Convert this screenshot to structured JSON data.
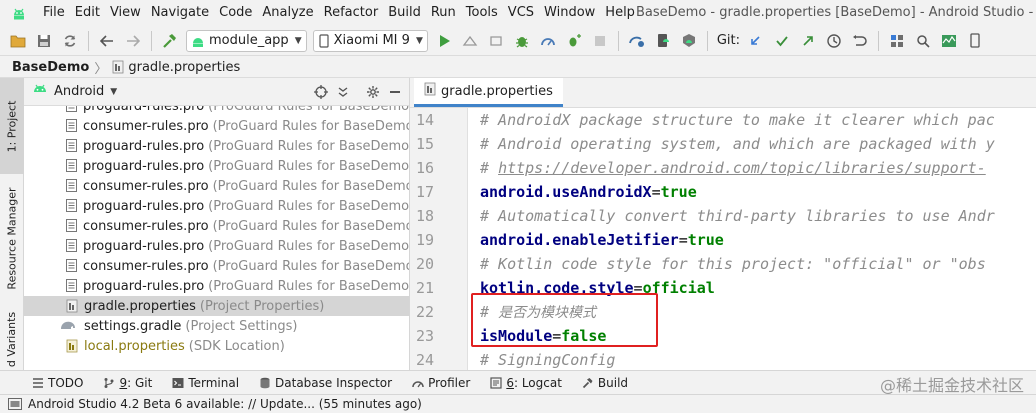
{
  "menu": {
    "items": [
      "File",
      "Edit",
      "View",
      "Navigate",
      "Code",
      "Analyze",
      "Refactor",
      "Build",
      "Run",
      "Tools",
      "VCS",
      "Window",
      "Help"
    ],
    "window_title": "BaseDemo - gradle.properties [BaseDemo] - Android Studio - Admi"
  },
  "toolbar": {
    "config_combo": "module_app",
    "device_combo": "Xiaomi MI 9",
    "git_label": "Git:"
  },
  "breadcrumb": {
    "root": "BaseDemo",
    "file": "gradle.properties"
  },
  "left_strip": {
    "project_tab": "1: Project",
    "resource_manager_tab": "Resource Manager",
    "build_variants_tab": "d Variants"
  },
  "project_panel": {
    "view_label": "Android",
    "rows": [
      {
        "name": "proguard-rules.pro",
        "desc": "(ProGuard Rules for BaseDemo.lib_r"
      },
      {
        "name": "consumer-rules.pro",
        "desc": "(ProGuard Rules for BaseDemo.lib_r"
      },
      {
        "name": "proguard-rules.pro",
        "desc": "(ProGuard Rules for BaseDemo.lib_r"
      },
      {
        "name": "proguard-rules.pro",
        "desc": "(ProGuard Rules for BaseDemo.moc"
      },
      {
        "name": "consumer-rules.pro",
        "desc": "(ProGuard Rules for BaseDemo.moc"
      },
      {
        "name": "proguard-rules.pro",
        "desc": "(ProGuard Rules for BaseDemo.moc"
      },
      {
        "name": "consumer-rules.pro",
        "desc": "(ProGuard Rules for BaseDemo.mou"
      },
      {
        "name": "proguard-rules.pro",
        "desc": "(ProGuard Rules for BaseDemo.mou"
      },
      {
        "name": "consumer-rules.pro",
        "desc": "(ProGuard Rules for BaseDemo.mou"
      },
      {
        "name": "proguard-rules.pro",
        "desc": "(ProGuard Rules for BaseDemo.mou"
      },
      {
        "name": "gradle.properties",
        "desc": "(Project Properties)"
      },
      {
        "name": "settings.gradle",
        "desc": "(Project Settings)"
      },
      {
        "name": "local.properties",
        "desc": "(SDK Location)"
      }
    ]
  },
  "editor": {
    "tab_label": "gradle.properties",
    "lines": [
      {
        "num": "14",
        "comment": "# AndroidX package structure to make it clearer which pac"
      },
      {
        "num": "15",
        "comment": "# Android operating system, and which are packaged with y"
      },
      {
        "num": "16",
        "comment_prefix": "# ",
        "link": "https://developer.android.com/topic/libraries/support-"
      },
      {
        "num": "17",
        "key": "android.useAndroidX",
        "eq": "=",
        "val": "true"
      },
      {
        "num": "18",
        "comment": "# Automatically convert third-party libraries to use Andr"
      },
      {
        "num": "19",
        "key": "android.enableJetifier",
        "eq": "=",
        "val": "true"
      },
      {
        "num": "20",
        "comment": "# Kotlin code style for this project: \"official\" or \"obs"
      },
      {
        "num": "21",
        "key": "kotlin.code.style",
        "eq": "=",
        "val": "official"
      },
      {
        "num": "22",
        "comment_prefix": "# ",
        "cn": "是否为模块模式"
      },
      {
        "num": "23",
        "key": "isModule",
        "eq": "=",
        "val": "false"
      },
      {
        "num": "24",
        "comment": "# SigningConfig"
      }
    ]
  },
  "bottom_tools": {
    "todo": "TODO",
    "git_num": "9",
    "git_rest": ": Git",
    "terminal": "Terminal",
    "db_inspector": "Database Inspector",
    "profiler": "Profiler",
    "logcat_num": "6",
    "logcat_rest": ": Logcat",
    "build": "Build"
  },
  "watermark": "@稀土掘金技术社区",
  "status": {
    "message": "Android Studio 4.2 Beta 6 available: // Update... (55 minutes ago)"
  },
  "colors": {
    "accent": "#4083c9",
    "highlight_box": "#e02020",
    "key": "#000080",
    "value": "#008000",
    "comment": "#8c8c8c"
  }
}
